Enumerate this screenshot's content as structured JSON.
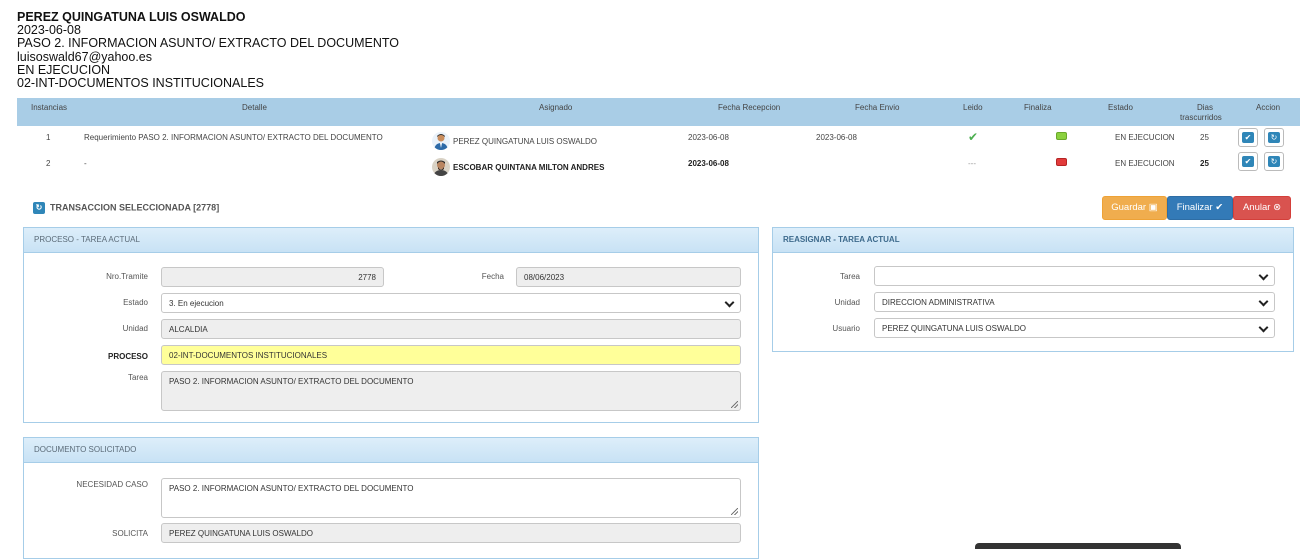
{
  "header": {
    "name": "PEREZ QUINGATUNA LUIS OSWALDO",
    "date": "2023-06-08",
    "task": "PASO 2. INFORMACION ASUNTO/ EXTRACTO DEL DOCUMENTO",
    "email": "luisoswald67@yahoo.es",
    "status": "EN EJECUCION",
    "process": "02-INT-DOCUMENTOS INSTITUCIONALES"
  },
  "table": {
    "columns": {
      "instancias": "Instancias",
      "detalle": "Detalle",
      "asignado": "Asignado",
      "fecha_recepcion": "Fecha Recepcion",
      "fecha_envio": "Fecha Envio",
      "leido": "Leido",
      "finaliza": "Finaliza",
      "estado": "Estado",
      "dias_1": "Dias",
      "dias_2": "trascurridos",
      "accion": "Accion"
    },
    "rows": [
      {
        "instancia": "1",
        "detalle": "Requerimiento PASO 2. INFORMACION ASUNTO/ EXTRACTO DEL DOCUMENTO",
        "asignado": "PEREZ QUINGATUNA LUIS OSWALDO",
        "fecha_recepcion": "2023-06-08",
        "fecha_envio": "2023-06-08",
        "leido": "✔",
        "finaliza_color": "#8bd13f",
        "estado": "EN EJECUCION",
        "dias": "25"
      },
      {
        "instancia": "2",
        "detalle": "-",
        "asignado": "ESCOBAR QUINTANA MILTON ANDRES",
        "fecha_recepcion": "2023-06-08",
        "fecha_envio": "",
        "leido": "---",
        "finaliza_color": "#e23b3b",
        "estado": "EN EJECUCION",
        "dias": "25"
      }
    ]
  },
  "transaction": {
    "label": "TRANSACCION SELECCIONADA [2778]"
  },
  "buttons": {
    "guardar": "Guardar",
    "finalizar": "Finalizar",
    "anular": "Anular"
  },
  "proceso_panel": {
    "title": "PROCESO - TAREA ACTUAL",
    "nro_tramite_label": "Nro.Tramite",
    "nro_tramite": "2778",
    "fecha_label": "Fecha",
    "fecha": "08/06/2023",
    "estado_label": "Estado",
    "estado": "3. En ejecucion",
    "unidad_label": "Unidad",
    "unidad": "ALCALDIA",
    "proceso_label": "PROCESO",
    "proceso": "02-INT-DOCUMENTOS INSTITUCIONALES",
    "tarea_label": "Tarea",
    "tarea": "PASO 2. INFORMACION ASUNTO/ EXTRACTO DEL DOCUMENTO"
  },
  "reasignar_panel": {
    "title": "REASIGNAR - TAREA ACTUAL",
    "tarea_label": "Tarea",
    "tarea": "",
    "unidad_label": "Unidad",
    "unidad": "DIRECCION ADMINISTRATIVA",
    "usuario_label": "Usuario",
    "usuario": "PEREZ QUINGATUNA LUIS OSWALDO"
  },
  "documento_panel": {
    "title": "DOCUMENTO SOLICITADO",
    "necesidad_label": "NECESIDAD CASO",
    "necesidad": "PASO 2. INFORMACION ASUNTO/ EXTRACTO DEL DOCUMENTO",
    "solicita_label": "SOLICITA",
    "solicita": "PEREZ QUINGATUNA LUIS OSWALDO"
  },
  "colors": {
    "header_bg": "#a9cde6",
    "guardar": "#f0ad4e",
    "finalizar": "#337ab7",
    "anular": "#d9534f",
    "proceso_highlight": "#ffff99"
  }
}
